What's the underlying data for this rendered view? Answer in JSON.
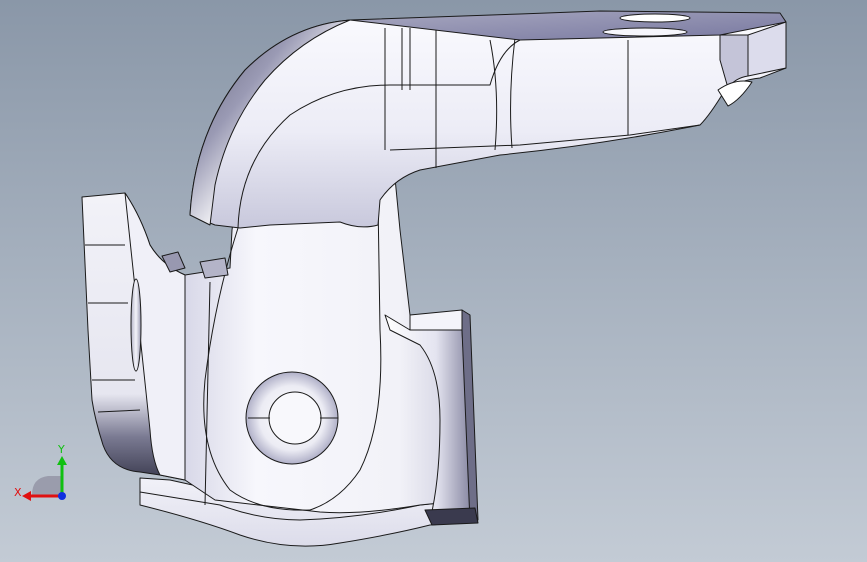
{
  "viewport": {
    "background_top": "#8a97a8",
    "background_bottom": "#c3cbd5"
  },
  "model": {
    "body_color": "#f2f2f8",
    "shadow_color": "#6a6a82",
    "edge_color": "#1a1a1a"
  },
  "triad": {
    "x_label": "X",
    "y_label": "Y",
    "x_color": "#e01010",
    "y_color": "#10c010",
    "z_color": "#1030e0"
  }
}
